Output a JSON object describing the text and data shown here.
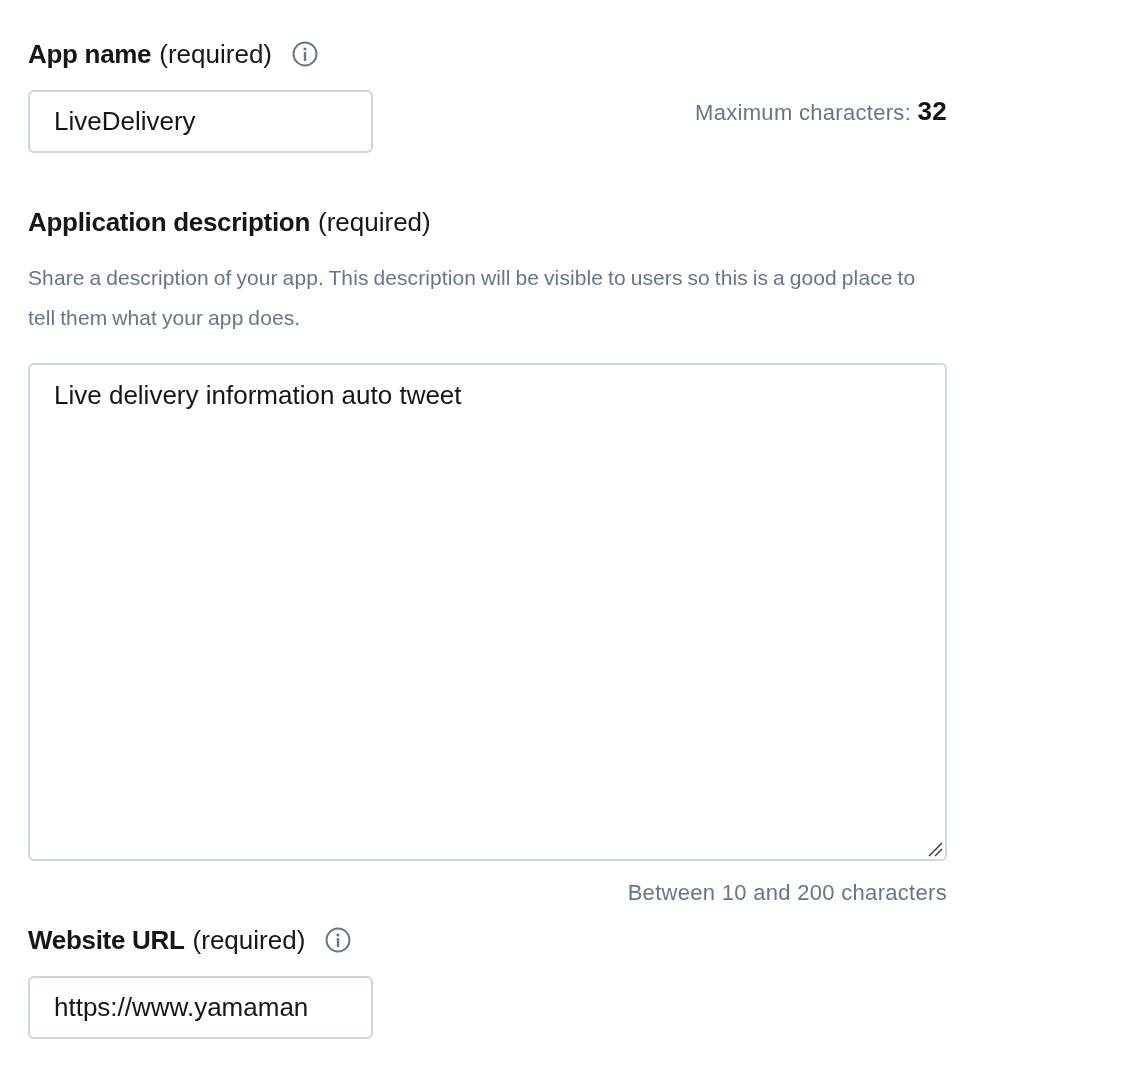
{
  "fields": [
    {
      "kind": "input",
      "label": "App name",
      "qualifier": "(required)",
      "info": true,
      "value": "LiveDelivery",
      "counter": "Maximum characters: **32**"
    },
    {
      "kind": "textarea",
      "label": "Application description",
      "qualifier": "(required)",
      "info": false,
      "help": "Share a description of your app. This description will be visible to users so this is a good place to tell them what your app does.",
      "value": "Live delivery information auto tweet",
      "hint": "Between 10 and 200 characters"
    },
    {
      "kind": "input",
      "label": "Website URL",
      "qualifier": "(required)",
      "info": true,
      "value": "https://www.yamaman"
    }
  ]
}
